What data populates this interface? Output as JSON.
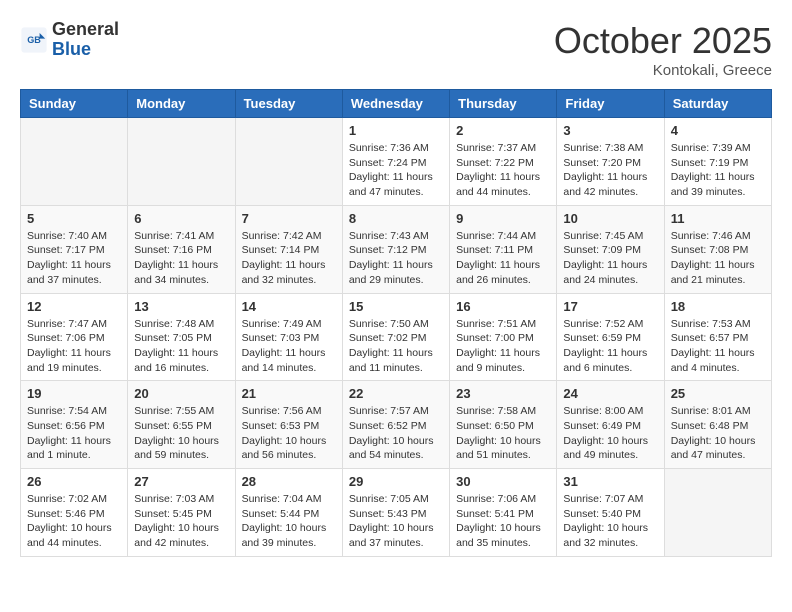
{
  "header": {
    "logo_line1": "General",
    "logo_line2": "Blue",
    "month": "October 2025",
    "location": "Kontokali, Greece"
  },
  "weekdays": [
    "Sunday",
    "Monday",
    "Tuesday",
    "Wednesday",
    "Thursday",
    "Friday",
    "Saturday"
  ],
  "weeks": [
    [
      {
        "day": "",
        "info": ""
      },
      {
        "day": "",
        "info": ""
      },
      {
        "day": "",
        "info": ""
      },
      {
        "day": "1",
        "info": "Sunrise: 7:36 AM\nSunset: 7:24 PM\nDaylight: 11 hours and 47 minutes."
      },
      {
        "day": "2",
        "info": "Sunrise: 7:37 AM\nSunset: 7:22 PM\nDaylight: 11 hours and 44 minutes."
      },
      {
        "day": "3",
        "info": "Sunrise: 7:38 AM\nSunset: 7:20 PM\nDaylight: 11 hours and 42 minutes."
      },
      {
        "day": "4",
        "info": "Sunrise: 7:39 AM\nSunset: 7:19 PM\nDaylight: 11 hours and 39 minutes."
      }
    ],
    [
      {
        "day": "5",
        "info": "Sunrise: 7:40 AM\nSunset: 7:17 PM\nDaylight: 11 hours and 37 minutes."
      },
      {
        "day": "6",
        "info": "Sunrise: 7:41 AM\nSunset: 7:16 PM\nDaylight: 11 hours and 34 minutes."
      },
      {
        "day": "7",
        "info": "Sunrise: 7:42 AM\nSunset: 7:14 PM\nDaylight: 11 hours and 32 minutes."
      },
      {
        "day": "8",
        "info": "Sunrise: 7:43 AM\nSunset: 7:12 PM\nDaylight: 11 hours and 29 minutes."
      },
      {
        "day": "9",
        "info": "Sunrise: 7:44 AM\nSunset: 7:11 PM\nDaylight: 11 hours and 26 minutes."
      },
      {
        "day": "10",
        "info": "Sunrise: 7:45 AM\nSunset: 7:09 PM\nDaylight: 11 hours and 24 minutes."
      },
      {
        "day": "11",
        "info": "Sunrise: 7:46 AM\nSunset: 7:08 PM\nDaylight: 11 hours and 21 minutes."
      }
    ],
    [
      {
        "day": "12",
        "info": "Sunrise: 7:47 AM\nSunset: 7:06 PM\nDaylight: 11 hours and 19 minutes."
      },
      {
        "day": "13",
        "info": "Sunrise: 7:48 AM\nSunset: 7:05 PM\nDaylight: 11 hours and 16 minutes."
      },
      {
        "day": "14",
        "info": "Sunrise: 7:49 AM\nSunset: 7:03 PM\nDaylight: 11 hours and 14 minutes."
      },
      {
        "day": "15",
        "info": "Sunrise: 7:50 AM\nSunset: 7:02 PM\nDaylight: 11 hours and 11 minutes."
      },
      {
        "day": "16",
        "info": "Sunrise: 7:51 AM\nSunset: 7:00 PM\nDaylight: 11 hours and 9 minutes."
      },
      {
        "day": "17",
        "info": "Sunrise: 7:52 AM\nSunset: 6:59 PM\nDaylight: 11 hours and 6 minutes."
      },
      {
        "day": "18",
        "info": "Sunrise: 7:53 AM\nSunset: 6:57 PM\nDaylight: 11 hours and 4 minutes."
      }
    ],
    [
      {
        "day": "19",
        "info": "Sunrise: 7:54 AM\nSunset: 6:56 PM\nDaylight: 11 hours and 1 minute."
      },
      {
        "day": "20",
        "info": "Sunrise: 7:55 AM\nSunset: 6:55 PM\nDaylight: 10 hours and 59 minutes."
      },
      {
        "day": "21",
        "info": "Sunrise: 7:56 AM\nSunset: 6:53 PM\nDaylight: 10 hours and 56 minutes."
      },
      {
        "day": "22",
        "info": "Sunrise: 7:57 AM\nSunset: 6:52 PM\nDaylight: 10 hours and 54 minutes."
      },
      {
        "day": "23",
        "info": "Sunrise: 7:58 AM\nSunset: 6:50 PM\nDaylight: 10 hours and 51 minutes."
      },
      {
        "day": "24",
        "info": "Sunrise: 8:00 AM\nSunset: 6:49 PM\nDaylight: 10 hours and 49 minutes."
      },
      {
        "day": "25",
        "info": "Sunrise: 8:01 AM\nSunset: 6:48 PM\nDaylight: 10 hours and 47 minutes."
      }
    ],
    [
      {
        "day": "26",
        "info": "Sunrise: 7:02 AM\nSunset: 5:46 PM\nDaylight: 10 hours and 44 minutes."
      },
      {
        "day": "27",
        "info": "Sunrise: 7:03 AM\nSunset: 5:45 PM\nDaylight: 10 hours and 42 minutes."
      },
      {
        "day": "28",
        "info": "Sunrise: 7:04 AM\nSunset: 5:44 PM\nDaylight: 10 hours and 39 minutes."
      },
      {
        "day": "29",
        "info": "Sunrise: 7:05 AM\nSunset: 5:43 PM\nDaylight: 10 hours and 37 minutes."
      },
      {
        "day": "30",
        "info": "Sunrise: 7:06 AM\nSunset: 5:41 PM\nDaylight: 10 hours and 35 minutes."
      },
      {
        "day": "31",
        "info": "Sunrise: 7:07 AM\nSunset: 5:40 PM\nDaylight: 10 hours and 32 minutes."
      },
      {
        "day": "",
        "info": ""
      }
    ]
  ]
}
